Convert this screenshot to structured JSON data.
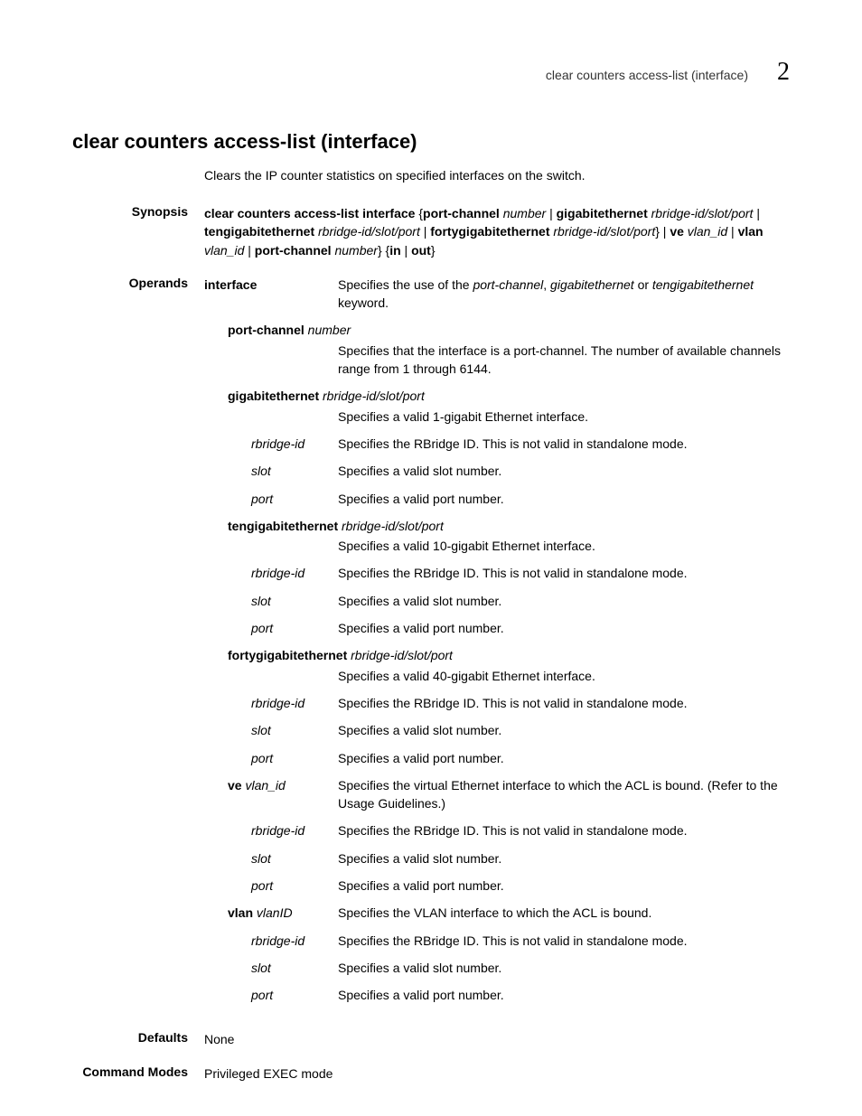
{
  "running_header": {
    "text": "clear counters access-list (interface)",
    "chapter": "2"
  },
  "title": "clear counters access-list (interface)",
  "intro": "Clears the IP counter statistics on specified interfaces on the switch.",
  "synopsis": {
    "label": "Synopsis",
    "parts": {
      "cmd": "clear counters access-list interface",
      "lbrace": " {",
      "pc_kw": "port-channel",
      "pc_arg": " number",
      "sep1": " | ",
      "ge_kw": "gigabitethernet",
      "ge_arg": " rbridge-id/slot/port",
      "sep2": " | ",
      "te_kw": "tengigabitethernet",
      "te_arg": " rbridge-id/slot/port",
      "sep3": " | ",
      "fe_kw": "fortygigabitethernet",
      "fe_arg": " rbridge-id/slot/port",
      "rbrace_sep": "} | ",
      "ve_kw": "ve",
      "ve_arg": " vlan_id",
      "sep4": " | ",
      "vlan_kw": "vlan",
      "vlan_arg": " vlan_id",
      "sep5": " | ",
      "pc2_kw": "port-channel",
      "pc2_arg": " number",
      "rbrace2": "} {",
      "in_kw": "in",
      "sep6": " | ",
      "out_kw": "out",
      "rbrace3": "}"
    }
  },
  "operands": {
    "label": "Operands",
    "rows": [
      {
        "indent": 0,
        "wide": false,
        "term_b": "interface",
        "term_i": "",
        "desc_pre": "Specifies the use of the ",
        "desc_i": "port-channel",
        "desc_mid": ", ",
        "desc_i2": "gigabitethernet",
        "desc_mid2": " or ",
        "desc_i3": "tengigabitethernet",
        "desc_post": " keyword."
      },
      {
        "indent": 1,
        "wide": true,
        "term_b": "port-channel",
        "term_i": " number",
        "desc": "Specifies that the interface is a port-channel. The number of available channels range from 1 through 6144."
      },
      {
        "indent": 1,
        "wide": true,
        "term_b": "gigabitethernet",
        "term_i": " rbridge-id/slot/port",
        "desc": "Specifies a valid 1-gigabit Ethernet interface."
      },
      {
        "indent": 2,
        "wide": false,
        "term_b": "",
        "term_i": "rbridge-id",
        "desc": "Specifies the RBridge ID. This is not valid in standalone mode."
      },
      {
        "indent": 2,
        "wide": false,
        "term_b": "",
        "term_i": "slot",
        "desc": "Specifies a valid slot number."
      },
      {
        "indent": 2,
        "wide": false,
        "term_b": "",
        "term_i": "port",
        "desc": "Specifies a valid port number."
      },
      {
        "indent": 1,
        "wide": true,
        "term_b": "tengigabitethernet",
        "term_i": " rbridge-id/slot/port",
        "desc": "Specifies a valid 10-gigabit Ethernet interface."
      },
      {
        "indent": 2,
        "wide": false,
        "term_b": "",
        "term_i": "rbridge-id",
        "desc": "Specifies the RBridge ID. This is not valid in standalone mode."
      },
      {
        "indent": 2,
        "wide": false,
        "term_b": "",
        "term_i": "slot",
        "desc": "Specifies a valid slot number."
      },
      {
        "indent": 2,
        "wide": false,
        "term_b": "",
        "term_i": "port",
        "desc": "Specifies a valid port number."
      },
      {
        "indent": 1,
        "wide": true,
        "term_b": "fortygigabitethernet",
        "term_i": " rbridge-id/slot/port",
        "desc": "Specifies a valid 40-gigabit Ethernet interface."
      },
      {
        "indent": 2,
        "wide": false,
        "term_b": "",
        "term_i": "rbridge-id",
        "desc": "Specifies the RBridge ID. This is not valid in standalone mode."
      },
      {
        "indent": 2,
        "wide": false,
        "term_b": "",
        "term_i": "slot",
        "desc": "Specifies a valid slot number."
      },
      {
        "indent": 2,
        "wide": false,
        "term_b": "",
        "term_i": "port",
        "desc": "Specifies a valid port number."
      },
      {
        "indent": 1,
        "wide": false,
        "term_b": "ve",
        "term_i": " vlan_id",
        "desc": "Specifies the virtual Ethernet interface to which the ACL is bound. (Refer to the Usage Guidelines.)"
      },
      {
        "indent": 2,
        "wide": false,
        "term_b": "",
        "term_i": "rbridge-id",
        "desc": "Specifies the RBridge ID. This is not valid in standalone mode."
      },
      {
        "indent": 2,
        "wide": false,
        "term_b": "",
        "term_i": "slot",
        "desc": "Specifies a valid slot number."
      },
      {
        "indent": 2,
        "wide": false,
        "term_b": "",
        "term_i": "port",
        "desc": "Specifies a valid port number."
      },
      {
        "indent": 1,
        "wide": false,
        "term_b": "vlan",
        "term_i": " vlanID",
        "desc": "Specifies the VLAN interface to which the ACL is bound."
      },
      {
        "indent": 2,
        "wide": false,
        "term_b": "",
        "term_i": "rbridge-id",
        "desc": "Specifies the RBridge ID. This is not valid in standalone mode."
      },
      {
        "indent": 2,
        "wide": false,
        "term_b": "",
        "term_i": "slot",
        "desc": "Specifies a valid slot number."
      },
      {
        "indent": 2,
        "wide": false,
        "term_b": "",
        "term_i": "port",
        "desc": "Specifies a valid port number."
      }
    ]
  },
  "defaults": {
    "label": "Defaults",
    "value": "None"
  },
  "command_modes": {
    "label": "Command Modes",
    "value": "Privileged EXEC mode"
  }
}
